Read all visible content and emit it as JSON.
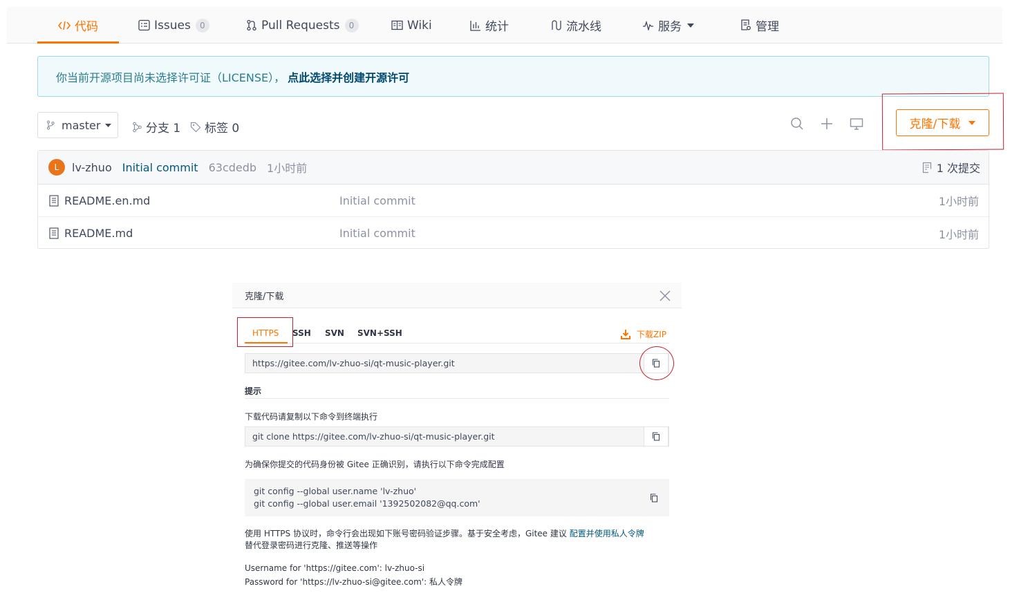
{
  "nav": {
    "tabs": [
      {
        "label": "代码",
        "icon": "code-icon",
        "active": true
      },
      {
        "label": "Issues",
        "count": "0",
        "icon": "issues-icon"
      },
      {
        "label": "Pull Requests",
        "count": "0",
        "icon": "pull-request-icon"
      },
      {
        "label": "Wiki",
        "icon": "wiki-icon"
      },
      {
        "label": "统计",
        "icon": "stats-icon"
      },
      {
        "label": "流水线",
        "icon": "pipeline-icon"
      },
      {
        "label": "服务",
        "icon": "service-icon",
        "dropdown": true
      },
      {
        "label": "管理",
        "icon": "manage-icon"
      }
    ],
    "accent_color": "#fe7300"
  },
  "license_banner": {
    "text": "你当前开源项目尚未选择许可证（LICENSE），",
    "link": "点此选择并创建开源许可"
  },
  "branch_bar": {
    "branch": "master",
    "branches_label": "分支 1",
    "tags_label": "标签 0",
    "clone_button": "克隆/下载"
  },
  "commit": {
    "avatar_letter": "L",
    "author": "lv-zhuo",
    "message": "Initial commit",
    "hash": "63cdedb",
    "time": "1小时前",
    "count_label": "1 次提交"
  },
  "files": [
    {
      "name": "README.en.md",
      "message": "Initial commit",
      "time": "1小时前"
    },
    {
      "name": "README.md",
      "message": "Initial commit",
      "time": "1小时前"
    }
  ],
  "clone_panel": {
    "title": "克隆/下载",
    "tabs": [
      "HTTPS",
      "SSH",
      "SVN",
      "SVN+SSH"
    ],
    "download_zip": "下载ZIP",
    "url": "https://gitee.com/lv-zhuo-si/qt-music-player.git",
    "hint_title": "提示",
    "hint_clone_text": "下载代码请复制以下命令到终端执行",
    "clone_command": "git clone https://gitee.com/lv-zhuo-si/qt-music-player.git",
    "hint_config_text": "为确保你提交的代码身份被 Gitee 正确识别，请执行以下命令完成配置",
    "config_line1": "git config --global user.name 'lv-zhuo'",
    "config_line2": "git config --global user.email '1392502082@qq.com'",
    "https_note_prefix": "使用 HTTPS 协议时，命令行会出现如下账号密码验证步骤。基于安全考虑，Gitee 建议",
    "https_note_link": "配置并使用私人令牌",
    "https_note_suffix": "替代登录密码进行克隆、推送等操作",
    "username_line": "Username for 'https://gitee.com': lv-zhuo-si",
    "password_line": "Password for 'https://lv-zhuo-si@gitee.com': 私人令牌"
  }
}
